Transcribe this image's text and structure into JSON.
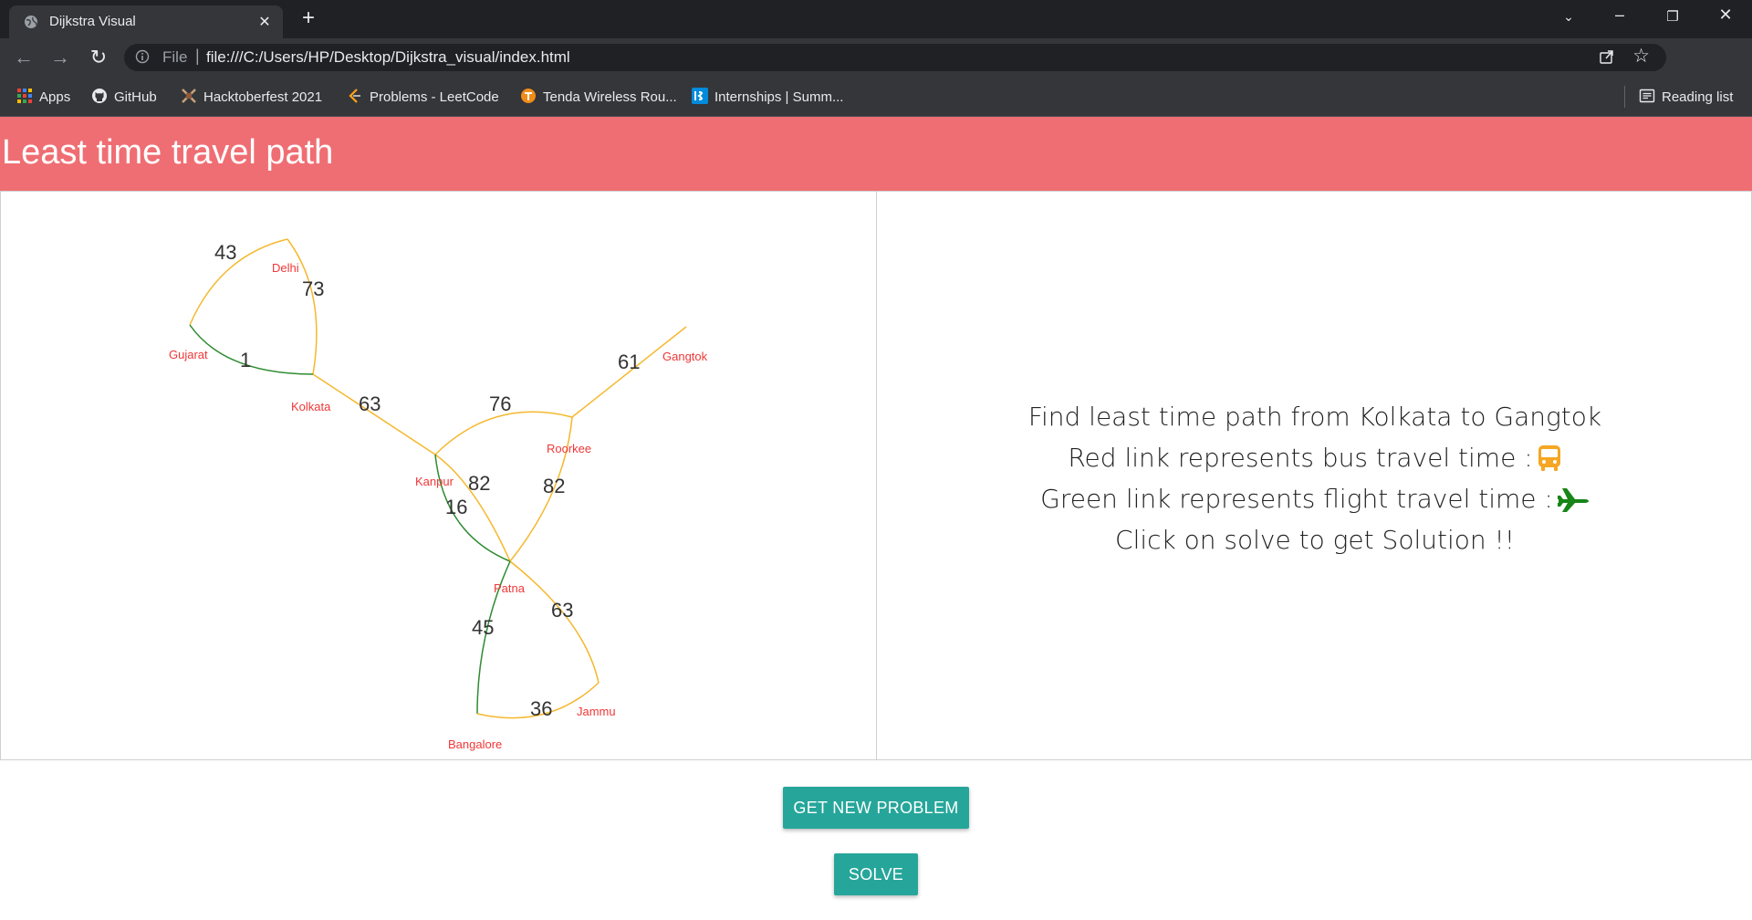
{
  "browser": {
    "tab_title": "Dijkstra Visual",
    "url_scheme": "File",
    "url": "file:///C:/Users/HP/Desktop/Dijkstra_visual/index.html",
    "bookmarks": [
      {
        "label": "Apps",
        "icon": "apps-grid-icon"
      },
      {
        "label": "GitHub",
        "icon": "github-icon"
      },
      {
        "label": "Hacktoberfest 2021",
        "icon": "hacktoberfest-icon"
      },
      {
        "label": "Problems - LeetCode",
        "icon": "leetcode-icon"
      },
      {
        "label": "Tenda Wireless Rou...",
        "icon": "tenda-icon"
      },
      {
        "label": "Internships | Summ...",
        "icon": "internshala-icon"
      }
    ],
    "reading_list": "Reading list"
  },
  "header": {
    "title": "Least time travel path"
  },
  "graph": {
    "nodes": {
      "delhi": "Delhi",
      "gujarat": "Gujarat",
      "kolkata": "Kolkata",
      "gangtok": "Gangtok",
      "roorkee": "Roorkee",
      "kanpur": "Kanpur",
      "patna": "Patna",
      "bangalore": "Bangalore",
      "jammu": "Jammu"
    },
    "edges": [
      {
        "from": "Gujarat",
        "to": "Delhi",
        "weight": "43",
        "mode": "bus"
      },
      {
        "from": "Delhi",
        "to": "Kolkata",
        "weight": "73",
        "mode": "bus"
      },
      {
        "from": "Gujarat",
        "to": "Kolkata",
        "weight": "1",
        "mode": "flight"
      },
      {
        "from": "Kolkata",
        "to": "Kanpur",
        "weight": "63",
        "mode": "bus"
      },
      {
        "from": "Kanpur",
        "to": "Roorkee",
        "weight": "76",
        "mode": "bus"
      },
      {
        "from": "Roorkee",
        "to": "Gangtok",
        "weight": "61",
        "mode": "bus"
      },
      {
        "from": "Kanpur",
        "to": "Patna",
        "weight": "82",
        "mode": "bus"
      },
      {
        "from": "Kanpur",
        "to": "Patna",
        "weight": "16",
        "mode": "flight"
      },
      {
        "from": "Roorkee",
        "to": "Patna",
        "weight": "82",
        "mode": "bus"
      },
      {
        "from": "Patna",
        "to": "Jammu",
        "weight": "63",
        "mode": "bus"
      },
      {
        "from": "Patna",
        "to": "Bangalore",
        "weight": "45",
        "mode": "flight"
      },
      {
        "from": "Bangalore",
        "to": "Jammu",
        "weight": "36",
        "mode": "bus"
      }
    ],
    "colors": {
      "bus": "#f5b82e",
      "flight": "#2e8b30",
      "node_label": "#f03737"
    }
  },
  "info": {
    "line1": "Find least time path from Kolkata to Gangtok",
    "line2": "Red link represents bus travel time :",
    "line3": "Green link represents flight travel time :",
    "line4": "Click on solve to get Solution !!",
    "bus_icon": "bus-icon",
    "plane_icon": "airplane-icon"
  },
  "buttons": {
    "new_problem": "GET NEW PROBLEM",
    "solve": "SOLVE"
  },
  "colors": {
    "header": "#ef6e73",
    "button": "#26a69a"
  }
}
